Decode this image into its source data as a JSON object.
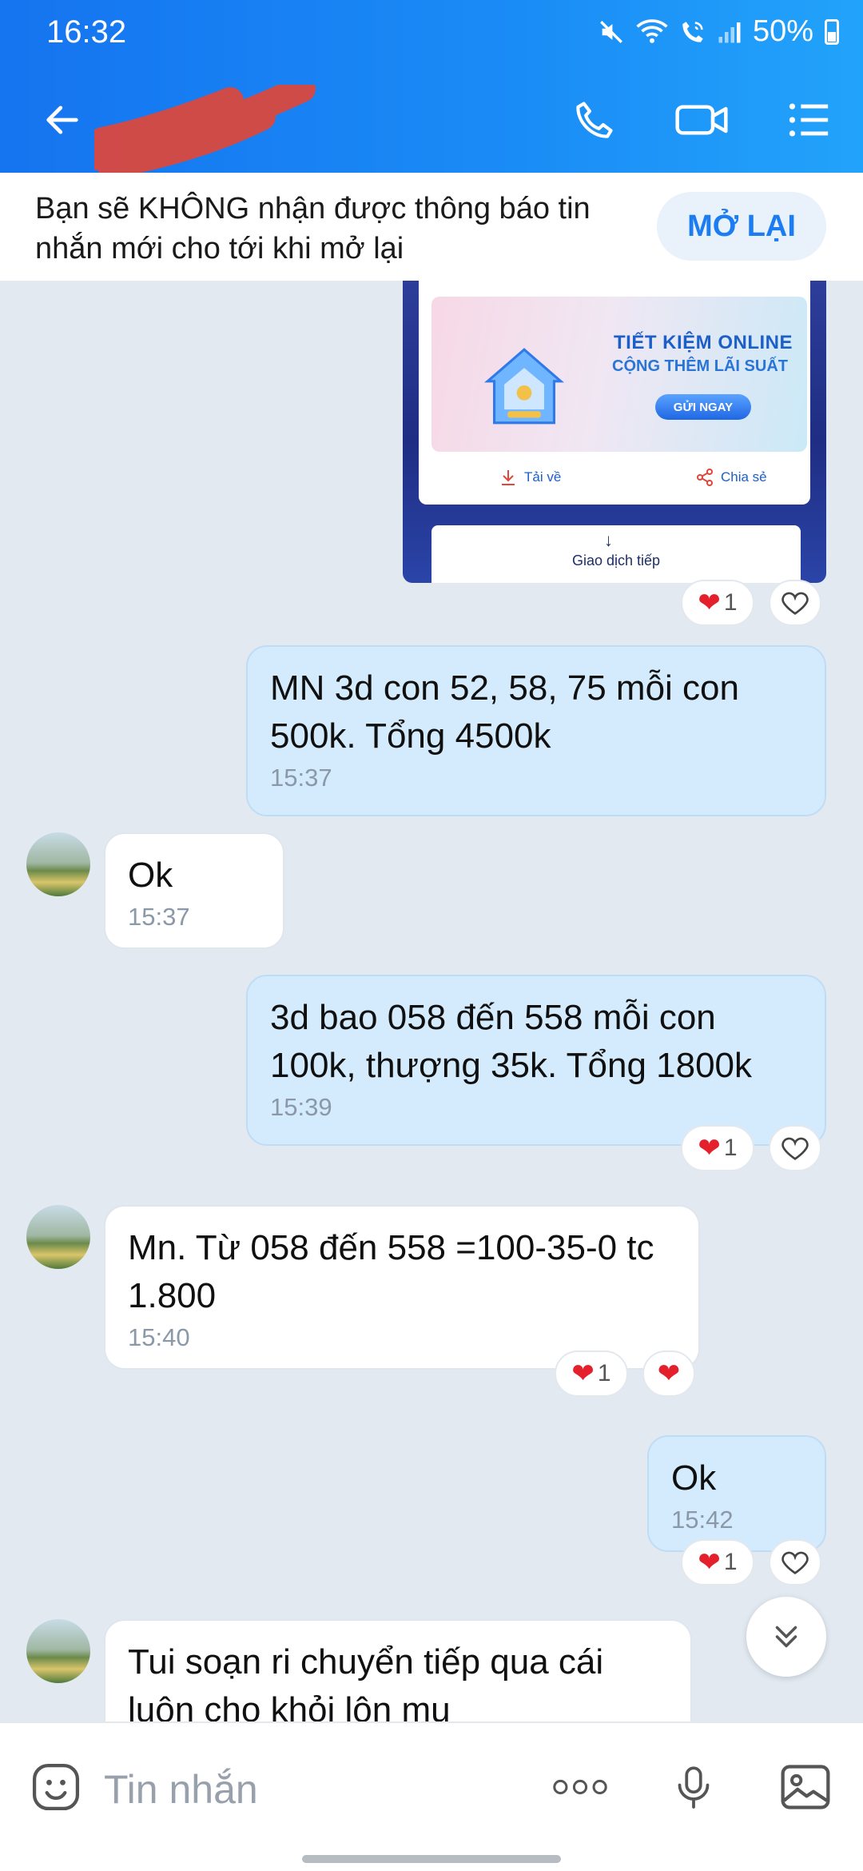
{
  "status_bar": {
    "time": "16:32",
    "battery": "50%",
    "icons": [
      "mute-icon",
      "wifi-icon",
      "wifi-call-icon",
      "signal-icon",
      "battery-icon"
    ]
  },
  "header": {
    "icons": [
      "back-arrow-icon",
      "phone-icon",
      "video-call-icon",
      "list-menu-icon"
    ],
    "accent": "#1a8cf6"
  },
  "notice": {
    "text": "Bạn sẽ KHÔNG nhận được thông báo tin nhắn mới cho tới khi mở lại",
    "button": "MỞ LẠI"
  },
  "promo": {
    "title": "TIẾT KIỆM ONLINE",
    "subtitle": "CỘNG THÊM LÃI SUẤT",
    "cta": "GỬI NGAY",
    "download": "Tải về",
    "share": "Chia sẻ",
    "continue": "Giao dịch tiếp"
  },
  "messages": [
    {
      "dir": "out",
      "text": "MN 3d con 52, 58, 75 mỗi con 500k. Tổng 4500k",
      "time": "15:37"
    },
    {
      "dir": "in",
      "text": "Ok",
      "time": "15:37"
    },
    {
      "dir": "out",
      "text": "3d bao 058 đến 558 mỗi con 100k, thượng 35k. Tổng 1800k",
      "time": "15:39"
    },
    {
      "dir": "in",
      "text": "Mn. Từ 058 đến 558 =100-35-0 tc 1.800",
      "time": "15:40"
    },
    {
      "dir": "out",
      "text": "Ok",
      "time": "15:42"
    },
    {
      "dir": "in",
      "text": "Tui soạn ri chuyển tiếp qua cái luôn cho khỏi lộn mu",
      "time": ""
    }
  ],
  "reactions": {
    "count": "1"
  },
  "input": {
    "placeholder": "Tin nhắn"
  },
  "colors": {
    "outgoing_bubble": "#d4ebfd",
    "incoming_bubble": "#ffffff",
    "chat_background": "#e2e9f1",
    "heart": "#e3202c"
  }
}
